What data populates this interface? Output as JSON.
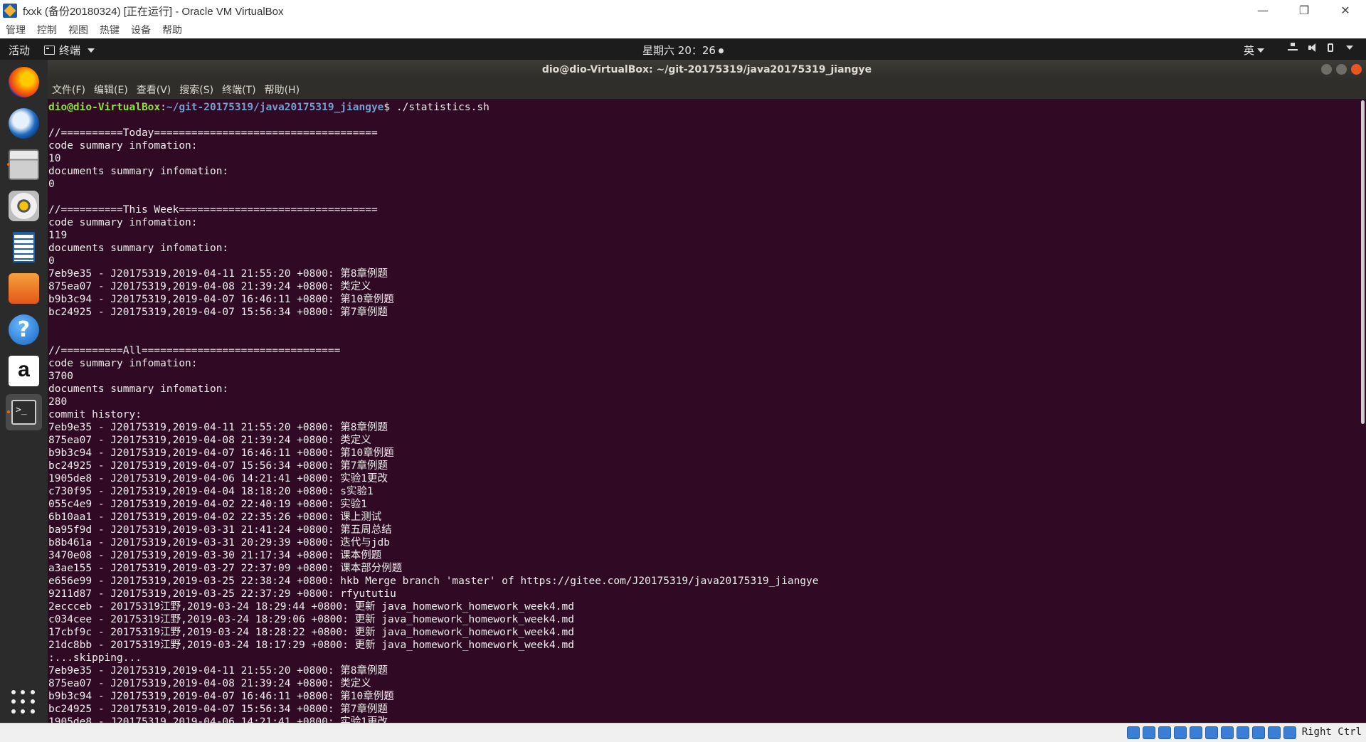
{
  "host_window": {
    "title": "fxxk (备份20180324) [正在运行] - Oracle VM VirtualBox",
    "minimize": "—",
    "restore": "❐",
    "close": "✕",
    "menu": [
      "管理",
      "控制",
      "视图",
      "热键",
      "设备",
      "帮助"
    ]
  },
  "gnome_topbar": {
    "activities": "活动",
    "app_menu": "终端",
    "clock": "星期六 20：26",
    "input_method": "英"
  },
  "terminal": {
    "title": "dio@dio-VirtualBox: ~/git-20175319/java20175319_jiangye",
    "menu": [
      "文件(F)",
      "编辑(E)",
      "查看(V)",
      "搜索(S)",
      "终端(T)",
      "帮助(H)"
    ],
    "prompt_user": "dio@dio-VirtualBox",
    "prompt_sep": ":",
    "prompt_path": "~/git-20175319/java20175319_jiangye",
    "prompt_command": "$ ./statistics.sh",
    "output": "\n//==========Today====================================\ncode summary infomation:\n10\ndocuments summary infomation:\n0\n\n//==========This Week================================\ncode summary infomation:\n119\ndocuments summary infomation:\n0\n7eb9e35 - J20175319,2019-04-11 21:55:20 +0800: 第8章例题\n875ea07 - J20175319,2019-04-08 21:39:24 +0800: 类定义\nb9b3c94 - J20175319,2019-04-07 16:46:11 +0800: 第10章例题\nbc24925 - J20175319,2019-04-07 15:56:34 +0800: 第7章例题\n\n\n//==========All================================\ncode summary infomation:\n3700\ndocuments summary infomation:\n280\ncommit history:\n7eb9e35 - J20175319,2019-04-11 21:55:20 +0800: 第8章例题\n875ea07 - J20175319,2019-04-08 21:39:24 +0800: 类定义\nb9b3c94 - J20175319,2019-04-07 16:46:11 +0800: 第10章例题\nbc24925 - J20175319,2019-04-07 15:56:34 +0800: 第7章例题\n1905de8 - J20175319,2019-04-06 14:21:41 +0800: 实验1更改\nc730f95 - J20175319,2019-04-04 18:18:20 +0800: s实验1\n055c4e9 - J20175319,2019-04-02 22:40:19 +0800: 实验1\n6b10aa1 - J20175319,2019-04-02 22:35:26 +0800: 课上测试\nba95f9d - J20175319,2019-03-31 21:41:24 +0800: 第五周总结\nb8b461a - J20175319,2019-03-31 20:29:39 +0800: 迭代与jdb\n3470e08 - J20175319,2019-03-30 21:17:34 +0800: 课本例题\na3ae155 - J20175319,2019-03-27 22:37:09 +0800: 课本部分例题\ne656e99 - J20175319,2019-03-25 22:38:24 +0800: hkb Merge branch 'master' of https://gitee.com/J20175319/java20175319_jiangye\n9211d87 - J20175319,2019-03-25 22:37:29 +0800: rfyututiu\n2eccceb - 20175319江野,2019-03-24 18:29:44 +0800: 更新 java_homework_homework_week4.md\nc034cee - 20175319江野,2019-03-24 18:29:06 +0800: 更新 java_homework_homework_week4.md\n17cbf9c - 20175319江野,2019-03-24 18:28:22 +0800: 更新 java_homework_homework_week4.md\n21dc8bb - 20175319江野,2019-03-24 18:17:29 +0800: 更新 java_homework_homework_week4.md\n:...skipping...\n7eb9e35 - J20175319,2019-04-11 21:55:20 +0800: 第8章例题\n875ea07 - J20175319,2019-04-08 21:39:24 +0800: 类定义\nb9b3c94 - J20175319,2019-04-07 16:46:11 +0800: 第10章例题\nbc24925 - J20175319,2019-04-07 15:56:34 +0800: 第7章例题\n1905de8 - J20175319,2019-04-06 14:21:41 +0800: 实验1更改"
  },
  "dock": {
    "apps": [
      "firefox-icon",
      "thunderbird-icon",
      "files-icon",
      "rhythmbox-icon",
      "libreoffice-writer-icon",
      "software-center-icon",
      "help-icon",
      "amazon-icon",
      "terminal-icon"
    ],
    "show_apps": "show-applications-icon"
  },
  "vb_status": {
    "host_key": "Right Ctrl"
  },
  "colors": {
    "terminal_bg": "#300a24",
    "prompt_user": "#8ae234",
    "prompt_path": "#729fcf",
    "ubuntu_orange": "#e95420"
  }
}
